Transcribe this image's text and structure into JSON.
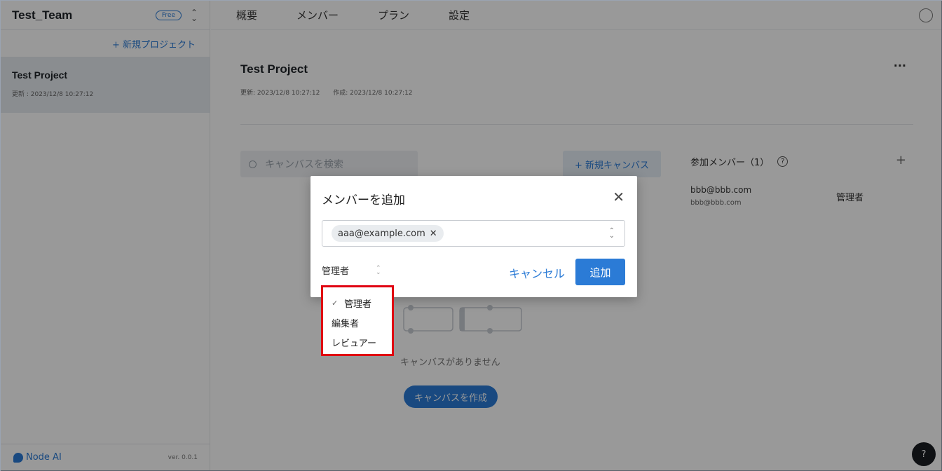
{
  "sidebar": {
    "team_name": "Test_Team",
    "plan_badge": "Free",
    "new_project": "+ 新規プロジェクト",
    "projects": [
      {
        "title": "Test Project",
        "meta": "更新 : 2023/12/8 10:27:12"
      }
    ],
    "footer_logo": "Node AI",
    "version": "ver. 0.0.1"
  },
  "nav": {
    "tabs": [
      "概要",
      "メンバー",
      "プラン",
      "設定"
    ]
  },
  "project": {
    "title": "Test Project",
    "updated": "更新: 2023/12/8 10:27:12",
    "created": "作成: 2023/12/8 10:27:12",
    "more": "···"
  },
  "canvas": {
    "search_placeholder": "キャンバスを検索",
    "new_canvas": "+ 新規キャンバス",
    "empty_text": "キャンバスがありません",
    "create_button": "キャンバスを作成"
  },
  "members": {
    "heading": "参加メンバー（1）",
    "help": "?",
    "add": "+",
    "list": [
      {
        "email": "bbb@bbb.com",
        "sub": "bbb@bbb.com",
        "role": "管理者"
      }
    ]
  },
  "modal": {
    "title": "メンバーを追加",
    "close": "✕",
    "chip": "aaa@example.com",
    "chip_remove": "✕",
    "selected_role": "管理者",
    "cancel": "キャンセル",
    "submit": "追加"
  },
  "dropdown": {
    "options": [
      {
        "label": "管理者",
        "checked": true
      },
      {
        "label": "編集者",
        "checked": false
      },
      {
        "label": "レビュアー",
        "checked": false
      }
    ],
    "highlight_color": "#e00010"
  },
  "help_fab": "?",
  "colors": {
    "accent": "#2b7bd6"
  }
}
